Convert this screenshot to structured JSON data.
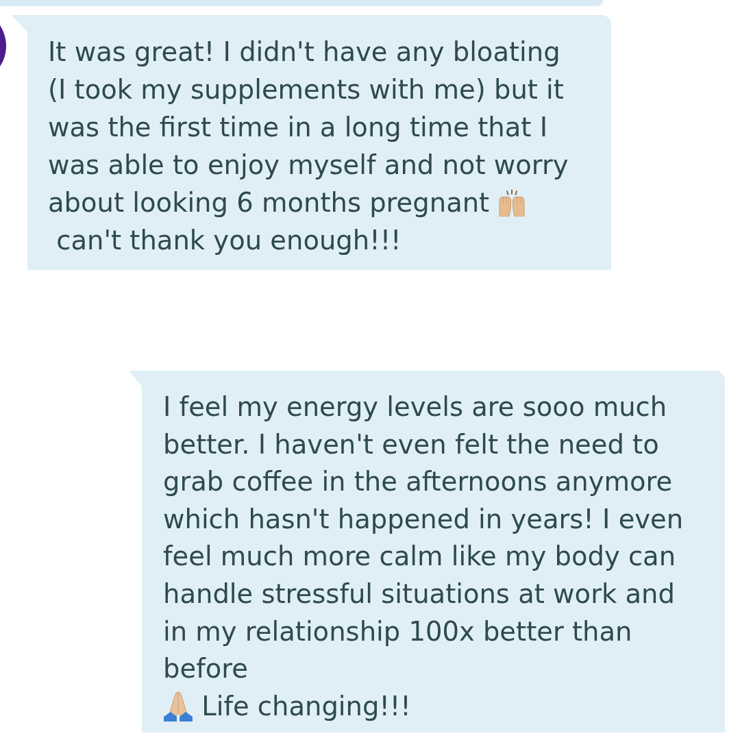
{
  "clipped_message_above": true,
  "messages": [
    {
      "avatar": true,
      "parts": [
        {
          "kind": "text",
          "text": "It was great! I didn't have any bloating (I took my supplements with me) but it was the first time in a long time that I was able to enjoy myself and not worry"
        },
        {
          "kind": "text",
          "text": "about looking 6 months pregnant"
        },
        {
          "kind": "cheer"
        },
        {
          "kind": "break"
        },
        {
          "kind": "text",
          "text": " can't thank you enough!!!"
        }
      ]
    },
    {
      "avatar": false,
      "parts": [
        {
          "kind": "text",
          "text": "I feel my energy levels are sooo much better. I haven't even felt the need to grab coffee in the afternoons anymore which hasn't happened in years! I even feel much more calm like my body can handle stressful situations at work and in my relationship 100x better than before"
        },
        {
          "kind": "break"
        },
        {
          "kind": "pray"
        },
        {
          "kind": "text",
          "text": " Life changing!!!"
        }
      ]
    }
  ]
}
